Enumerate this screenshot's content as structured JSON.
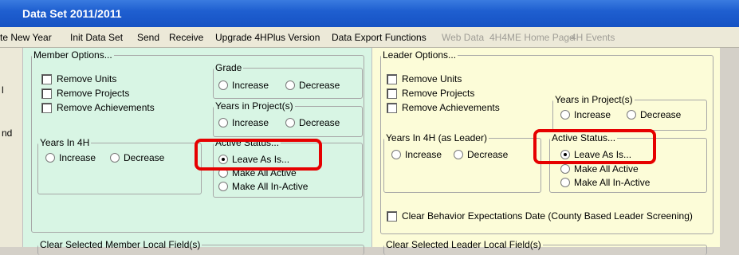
{
  "window": {
    "title": "Data Set 2011/2011"
  },
  "menu": [
    {
      "label": "te New Year",
      "enabled": true
    },
    {
      "label": "Init Data Set",
      "enabled": true
    },
    {
      "label": "Send",
      "enabled": true
    },
    {
      "label": "Receive",
      "enabled": true
    },
    {
      "label": "Upgrade 4HPlus Version",
      "enabled": true
    },
    {
      "label": "Data Export Functions",
      "enabled": true
    },
    {
      "label": "Web Data",
      "enabled": false
    },
    {
      "label": "4H4ME Home Page",
      "enabled": false
    },
    {
      "label": "4H Events",
      "enabled": false
    }
  ],
  "left_strip": {
    "label_1": "l",
    "label_2": "nd"
  },
  "member": {
    "group_title": "Member Options...",
    "checkboxes": [
      "Remove Units",
      "Remove Projects",
      "Remove Achievements"
    ],
    "grade": {
      "title": "Grade",
      "increase": "Increase",
      "decrease": "Decrease"
    },
    "years_in_project": {
      "title": "Years in Project(s)",
      "increase": "Increase",
      "decrease": "Decrease"
    },
    "years_in_4h": {
      "title": "Years In 4H",
      "increase": "Increase",
      "decrease": "Decrease"
    },
    "active_status": {
      "title": "Active Status...",
      "options": [
        "Leave As Is...",
        "Make All Active",
        "Make All In-Active"
      ],
      "selected": "Leave As Is..."
    },
    "clear_local_fields": "Clear Selected Member Local Field(s)"
  },
  "leader": {
    "group_title": "Leader Options...",
    "checkboxes": [
      "Remove Units",
      "Remove Projects",
      "Remove Achievements"
    ],
    "years_in_project": {
      "title": "Years in Project(s)",
      "increase": "Increase",
      "decrease": "Decrease"
    },
    "years_in_4h": {
      "title": "Years In 4H  (as Leader)",
      "increase": "Increase",
      "decrease": "Decrease"
    },
    "active_status": {
      "title": "Active Status...",
      "options": [
        "Leave As Is...",
        "Make All Active",
        "Make All In-Active"
      ],
      "selected": "Leave As Is..."
    },
    "clear_behavior": "Clear Behavior Expectations Date (County Based Leader Screening)",
    "clear_local_fields": "Clear Selected Leader Local Field(s)"
  },
  "colors": {
    "title_bar": "#1f5fd0",
    "member_panel": "#d8f5e4",
    "leader_panel": "#fcfcd8",
    "highlight": "#e60000"
  }
}
